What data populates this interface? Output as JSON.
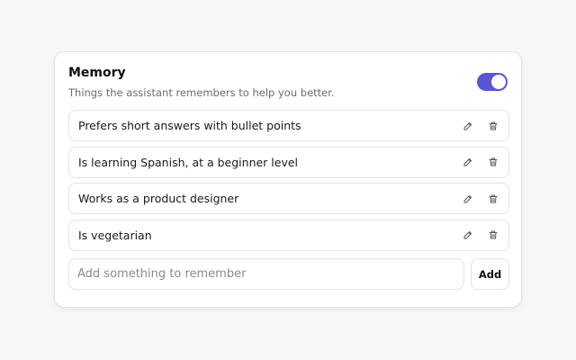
{
  "memory": {
    "title": "Memory",
    "subtitle": "Things the assistant remembers to help you better.",
    "toggle_on": true,
    "accent_color": "#5b54d6",
    "items": [
      {
        "text": "Prefers short answers with bullet points",
        "edit_icon": "pencil-icon",
        "delete_icon": "trash-icon"
      },
      {
        "text": "Is learning Spanish, at a beginner level",
        "edit_icon": "pencil-icon",
        "delete_icon": "trash-icon"
      },
      {
        "text": "Works as a product designer",
        "edit_icon": "pencil-icon",
        "delete_icon": "trash-icon"
      },
      {
        "text": "Is vegetarian",
        "edit_icon": "pencil-icon",
        "delete_icon": "trash-icon"
      }
    ],
    "add_input": {
      "value": "",
      "placeholder": "Add something to remember"
    },
    "add_label": "Add"
  }
}
